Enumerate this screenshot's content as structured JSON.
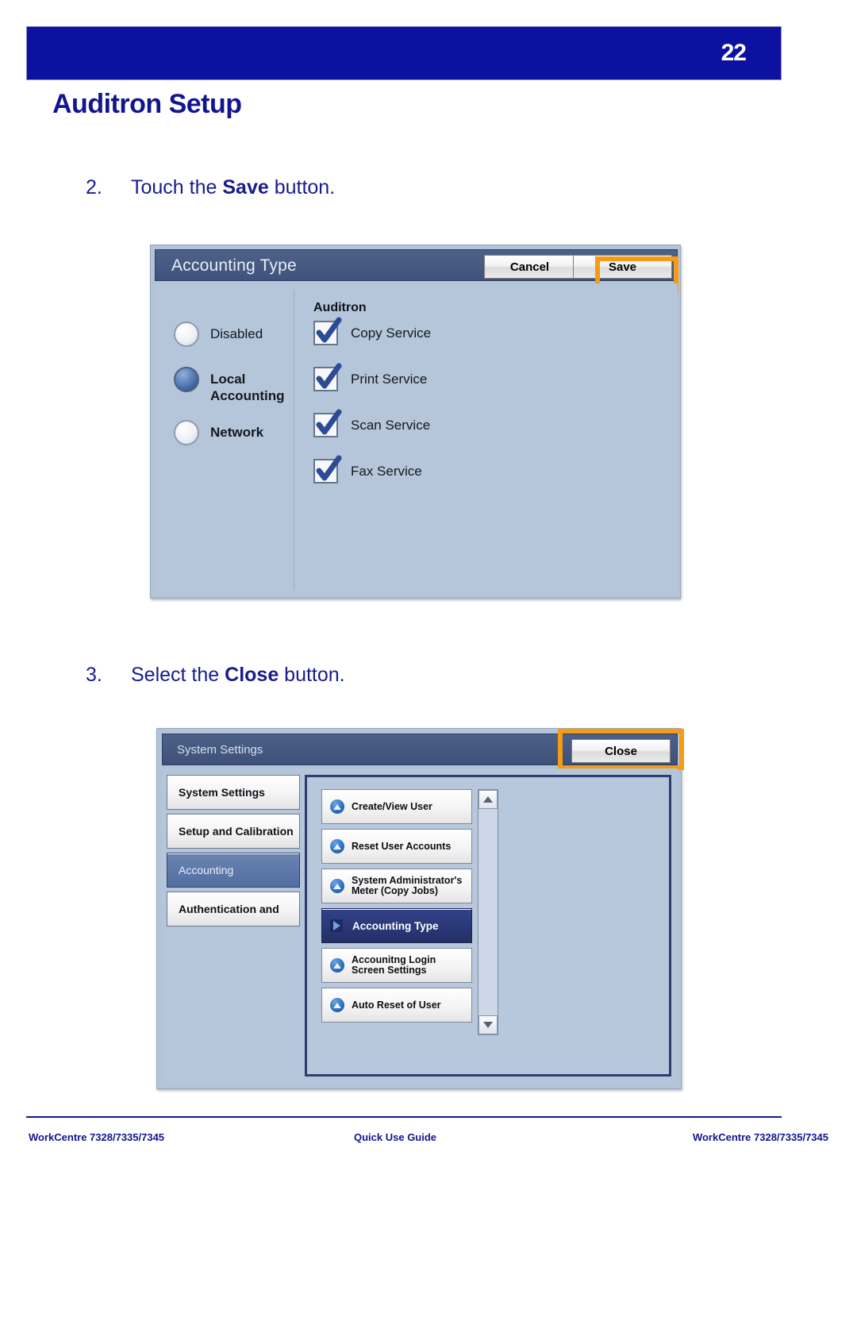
{
  "header": {
    "page_number": "22",
    "doc_title": "Auditron Setup"
  },
  "steps": [
    {
      "number": "2.",
      "pre": "Touch the ",
      "bold": "Save",
      "post": " button."
    },
    {
      "number": "3.",
      "pre": "Select the ",
      "bold": "Close",
      "post": " button."
    }
  ],
  "panel_accounting_type": {
    "title": "Accounting Type",
    "cancel_label": "Cancel",
    "save_label": "Save",
    "highlight_color": "#f59b14",
    "radio_group_label": "",
    "radios": [
      {
        "label": "Disabled",
        "selected": false,
        "bold": false
      },
      {
        "label": "Local\nAccounting",
        "selected": true,
        "bold": true
      },
      {
        "label": "Network",
        "selected": false,
        "bold": true
      }
    ],
    "group_title": "Auditron",
    "checkboxes": [
      {
        "label": "Copy Service",
        "checked": true
      },
      {
        "label": "Print Service",
        "checked": true
      },
      {
        "label": "Scan Service",
        "checked": true
      },
      {
        "label": "Fax Service",
        "checked": true
      }
    ]
  },
  "panel_system_settings": {
    "title": "System Settings",
    "close_label": "Close",
    "highlight_color": "#f59b14",
    "tabs": [
      {
        "label": "System Settings",
        "active": false
      },
      {
        "label": "Setup and Calibration",
        "active": false
      },
      {
        "label": "Accounting",
        "active": true
      },
      {
        "label": "Authentication and",
        "active": false
      }
    ],
    "list_items": [
      {
        "label": "Create/View User",
        "selected": false
      },
      {
        "label": "Reset User Accounts",
        "selected": false
      },
      {
        "label": "System Administrator's\nMeter (Copy Jobs)",
        "selected": false
      },
      {
        "label": "Accounting Type",
        "selected": true
      },
      {
        "label": "Accounitng Login\nScreen Settings",
        "selected": false
      },
      {
        "label": "Auto Reset of User",
        "selected": false
      }
    ]
  },
  "footer": {
    "left": "WorkCentre 7328/7335/7345",
    "middle": "Quick Use Guide",
    "right": "WorkCentre 7328/7335/7345"
  }
}
